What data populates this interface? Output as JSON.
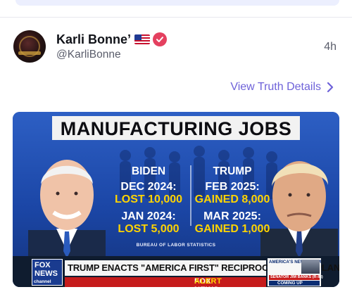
{
  "post": {
    "author_name": "Karli Bonne’",
    "handle": "@KarliBonne",
    "time": "4h",
    "view_details_label": "View Truth Details"
  },
  "image": {
    "headline": "MANUFACTURING JOBS",
    "left": {
      "name": "BIDEN",
      "line1_date": "DEC 2024:",
      "line1_value": "LOST 10,000",
      "line2_date": "JAN 2024:",
      "line2_value": "LOST 5,000"
    },
    "right": {
      "name": "TRUMP",
      "line1_date": "FEB 2025:",
      "line1_value": "GAINED 8,000",
      "line2_date": "MAR 2025:",
      "line2_value": "GAINED 1,000"
    },
    "source": "BUREAU OF LABOR STATISTICS",
    "chyron": {
      "logo_line1": "FOX",
      "logo_line2": "NEWS",
      "logo_line3": "channel",
      "headline": "TRUMP ENACTS \"AMERICA FIRST\" RECIPROCAL TRADE PLAN",
      "alert_fox": "FOX NEWS",
      "alert_word": "ALERT",
      "newsroom": "AMERICA'S NEWSROOM",
      "senator": "SENATOR JIM BANKS (R-IN)",
      "coming_up": "COMING UP"
    }
  },
  "colors": {
    "accent_link": "#6e62d9",
    "verified_badge": "#e4405f"
  },
  "icons": {
    "verified": "verified-badge-icon",
    "flag": "us-flag-icon",
    "chevron": "chevron-right-icon"
  }
}
